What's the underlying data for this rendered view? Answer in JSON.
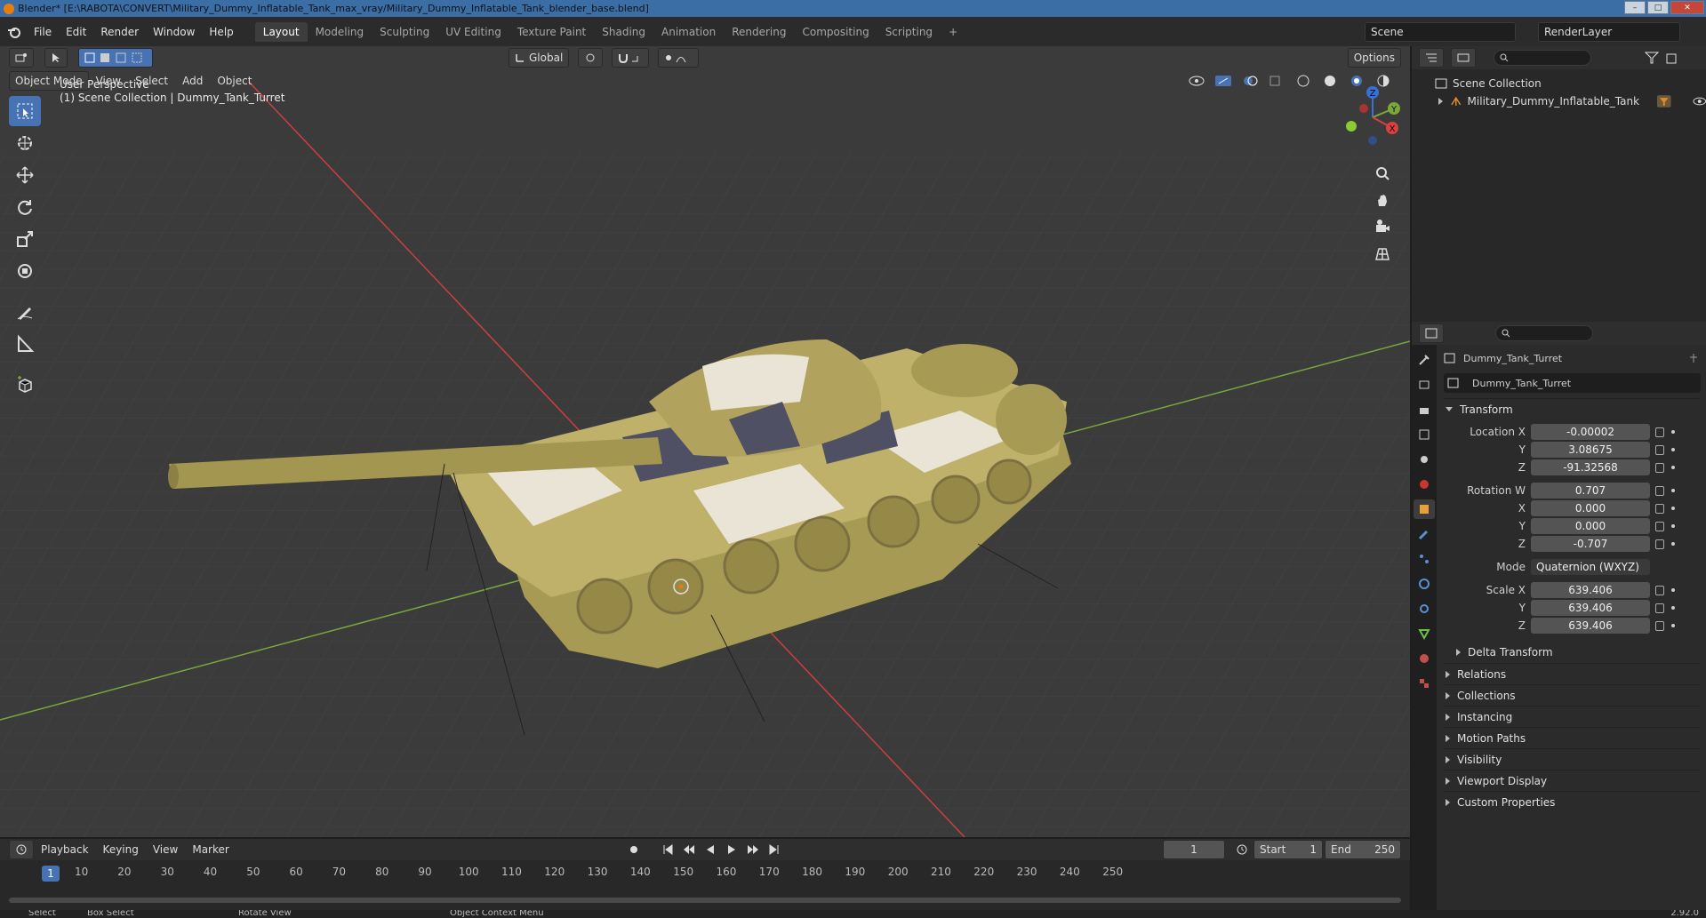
{
  "title": "Blender* [E:\\RABOTA\\CONVERT\\Military_Dummy_Inflatable_Tank_max_vray/Military_Dummy_Inflatable_Tank_blender_base.blend]",
  "menus": [
    "File",
    "Edit",
    "Render",
    "Window",
    "Help"
  ],
  "workspaces": [
    "Layout",
    "Modeling",
    "Sculpting",
    "UV Editing",
    "Texture Paint",
    "Shading",
    "Animation",
    "Rendering",
    "Compositing",
    "Scripting"
  ],
  "active_workspace": "Layout",
  "add_workspace": "+",
  "scene": "Scene",
  "render_layer": "RenderLayer",
  "viewport": {
    "mode": "Object Mode",
    "menus": [
      "View",
      "Select",
      "Add",
      "Object"
    ],
    "transform_orientation": "Global",
    "options": "Options",
    "perspective": "User Perspective",
    "context": "(1) Scene Collection | Dummy_Tank_Turret",
    "gizmo": {
      "x": "X",
      "y": "Y",
      "z": "Z"
    }
  },
  "outliner": {
    "root": "Scene Collection",
    "items": [
      {
        "label": "Military_Dummy_Inflatable_Tank"
      }
    ]
  },
  "properties": {
    "object_name": "Dummy_Tank_Turret",
    "data_name": "Dummy_Tank_Turret",
    "transform_title": "Transform",
    "location": {
      "label_x": "Location X",
      "x": "-0.00002",
      "label_y": "Y",
      "y": "3.08675",
      "label_z": "Z",
      "z": "-91.32568"
    },
    "rotation": {
      "label_w": "Rotation W",
      "w": "0.707",
      "label_x": "X",
      "x": "0.000",
      "label_y": "Y",
      "y": "0.000",
      "label_z": "Z",
      "z": "-0.707"
    },
    "mode_label": "Mode",
    "mode": "Quaternion (WXYZ)",
    "scale": {
      "label_x": "Scale X",
      "x": "639.406",
      "label_y": "Y",
      "y": "639.406",
      "label_z": "Z",
      "z": "639.406"
    },
    "delta": "Delta Transform",
    "panels": [
      "Relations",
      "Collections",
      "Instancing",
      "Motion Paths",
      "Visibility",
      "Viewport Display",
      "Custom Properties"
    ]
  },
  "timeline": {
    "menus": [
      "Playback",
      "Keying",
      "View",
      "Marker"
    ],
    "current_frame": "1",
    "start_label": "Start",
    "start": "1",
    "end_label": "End",
    "end": "250",
    "ticks": [
      "10",
      "20",
      "30",
      "40",
      "50",
      "60",
      "70",
      "80",
      "90",
      "100",
      "110",
      "120",
      "130",
      "140",
      "150",
      "160",
      "170",
      "180",
      "190",
      "200",
      "210",
      "220",
      "230",
      "240",
      "250"
    ]
  },
  "status": {
    "select": "Select",
    "box_select": "Box Select",
    "rotate": "Rotate View",
    "context": "Object Context Menu",
    "version": "2.92.0"
  },
  "colors": {
    "accent": "#4772b3",
    "viewport_bg": "#3b3b3b",
    "tank_olive": "#a79a55",
    "x_axis": "#d9403f",
    "y_axis": "#7aa83a"
  }
}
